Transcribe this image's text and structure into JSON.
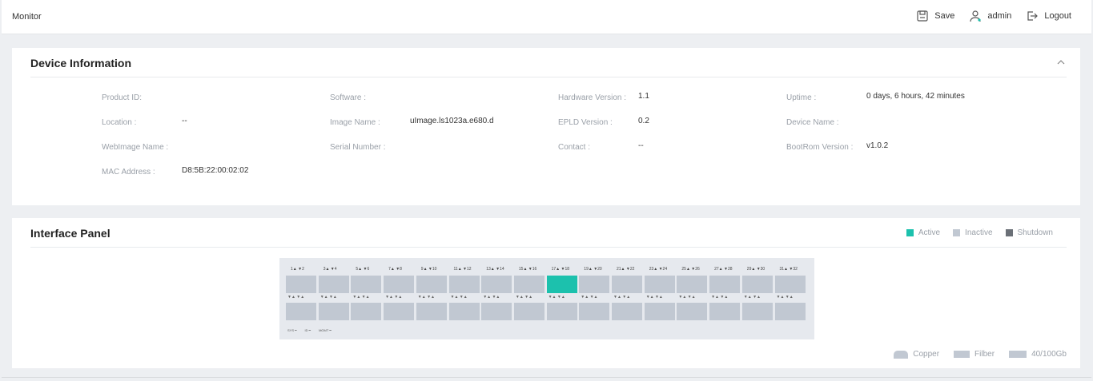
{
  "topbar": {
    "title": "Monitor",
    "save_label": "Save",
    "user_label": "admin",
    "logout_label": "Logout"
  },
  "device_info": {
    "heading": "Device Information",
    "fields": [
      {
        "label": "Product ID:",
        "value": ""
      },
      {
        "label": "Software :",
        "value": ""
      },
      {
        "label": "Hardware Version :",
        "value": "1.1"
      },
      {
        "label": "Uptime :",
        "value": "0 days, 6 hours, 42 minutes"
      },
      {
        "label": "Location :",
        "value": "--"
      },
      {
        "label": "Image Name :",
        "value": "uImage.ls1023a.e680.d"
      },
      {
        "label": "EPLD Version :",
        "value": "0.2"
      },
      {
        "label": "Device Name :",
        "value": ""
      },
      {
        "label": "WebImage Name :",
        "value": ""
      },
      {
        "label": "Serial Number :",
        "value": ""
      },
      {
        "label": "Contact :",
        "value": "--"
      },
      {
        "label": "BootRom Version :",
        "value": "v1.0.2"
      },
      {
        "label": "MAC Address :",
        "value": "D8:5B:22:00:02:02"
      }
    ]
  },
  "interface_panel": {
    "heading": "Interface Panel",
    "legend": [
      {
        "label": "Active",
        "color": "#1cc1ad"
      },
      {
        "label": "Inactive",
        "color": "#c1c8d2"
      },
      {
        "label": "Shutdown",
        "color": "#6b7077"
      }
    ],
    "port_labels": [
      "1▲ ▼2",
      "3▲ ▼4",
      "5▲ ▼6",
      "7▲ ▼8",
      "9▲ ▼10",
      "11▲ ▼12",
      "13▲ ▼14",
      "15▲ ▼16",
      "17▲ ▼18",
      "19▲ ▼20",
      "21▲ ▼22",
      "23▲ ▼24",
      "25▲ ▼26",
      "27▲ ▼28",
      "29▲ ▼30",
      "31▲ ▼32"
    ],
    "active_top_index": 8,
    "indicator_text": "▼▲ ▼▲",
    "footer": {
      "sys": "SYS",
      "id": "ID",
      "mgmt": "MGMT"
    },
    "media_legend": [
      {
        "label": "Copper"
      },
      {
        "label": "Filber"
      },
      {
        "label": "40/100Gb"
      }
    ]
  },
  "colors": {
    "active": "#1cc1ad",
    "inactive": "#c1c8d2",
    "shutdown": "#6b7077"
  }
}
